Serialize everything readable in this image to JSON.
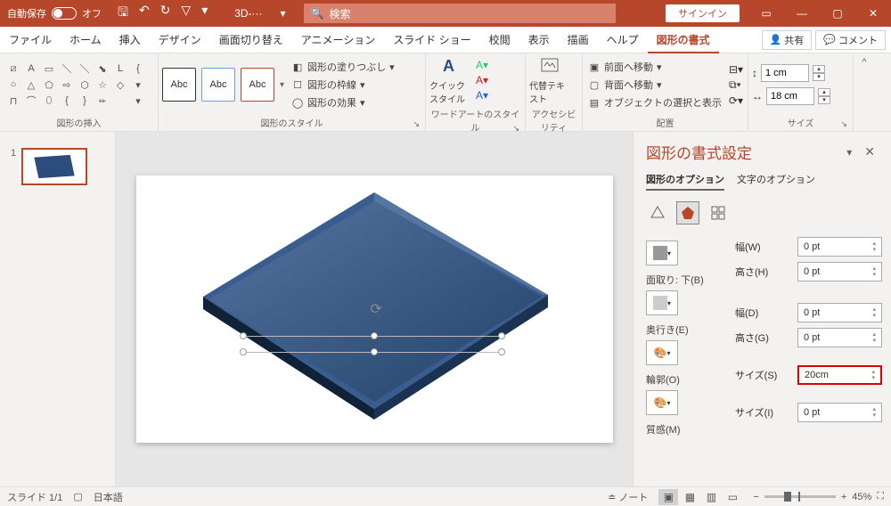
{
  "titlebar": {
    "autosave_label": "自動保存",
    "autosave_state": "オフ",
    "doc_title": "3D-···",
    "search_placeholder": "検索",
    "signin": "サインイン"
  },
  "tabs": {
    "items": [
      "ファイル",
      "ホーム",
      "挿入",
      "デザイン",
      "画面切り替え",
      "アニメーション",
      "スライド ショー",
      "校閲",
      "表示",
      "描画",
      "ヘルプ",
      "図形の書式"
    ],
    "active_index": 11,
    "share": "共有",
    "comment": "コメント"
  },
  "ribbon": {
    "insert_shapes": "図形の挿入",
    "shape_styles": "図形のスタイル",
    "wordart": "ワードアートのスタイル",
    "accessibility": "アクセシビリティ",
    "arrange": "配置",
    "size": "サイズ",
    "abc": "Abc",
    "fill": "図形の塗りつぶし",
    "outline": "図形の枠線",
    "effects": "図形の効果",
    "quickstyle": "クイック スタイル",
    "alttext": "代替テキスト",
    "bring_forward": "前面へ移動",
    "send_backward": "背面へ移動",
    "selection_pane": "オブジェクトの選択と表示",
    "height_val": "1 cm",
    "width_val": "18 cm"
  },
  "thumbs": {
    "num": "1"
  },
  "pane": {
    "title": "図形の書式設定",
    "shape_options": "図形のオプション",
    "text_options": "文字のオプション",
    "bevel_bottom": "面取り: 下(B)",
    "depth": "奥行き(E)",
    "contour": "輪郭(O)",
    "material": "質感(M)",
    "width_w": "幅(W)",
    "height_h": "高さ(H)",
    "width_d": "幅(D)",
    "height_g": "高さ(G)",
    "size_s": "サイズ(S)",
    "size_i": "サイズ(I)",
    "zero_pt": "0 pt",
    "depth_val": "20cm"
  },
  "status": {
    "slide": "スライド 1/1",
    "lang": "日本語",
    "notes": "ノート",
    "zoom": "45%"
  }
}
